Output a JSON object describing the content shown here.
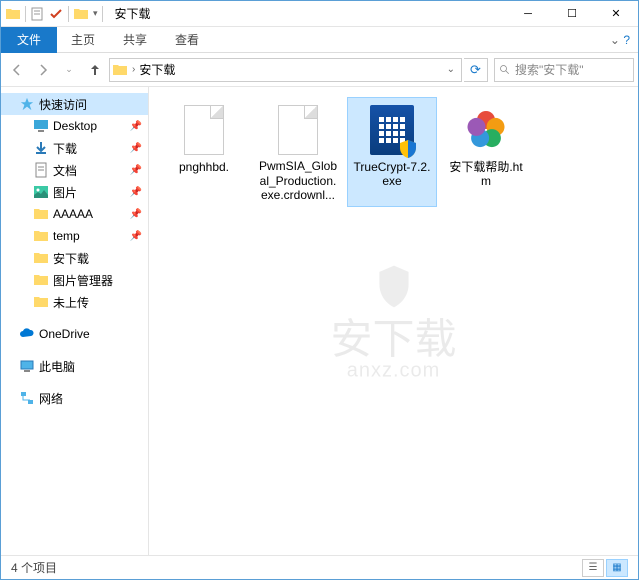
{
  "window": {
    "title": "安下载"
  },
  "ribbon": {
    "file": "文件",
    "home": "主页",
    "share": "共享",
    "view": "查看"
  },
  "address": {
    "current": "安下载",
    "search_placeholder": "搜索\"安下载\""
  },
  "nav": {
    "quick_access": "快速访问",
    "items": [
      {
        "label": "Desktop",
        "icon": "desktop",
        "pinned": true
      },
      {
        "label": "下载",
        "icon": "download",
        "pinned": true
      },
      {
        "label": "文档",
        "icon": "doc",
        "pinned": true
      },
      {
        "label": "图片",
        "icon": "picture",
        "pinned": true
      },
      {
        "label": "AAAAA",
        "icon": "folder",
        "pinned": true
      },
      {
        "label": "temp",
        "icon": "folder",
        "pinned": true
      },
      {
        "label": "安下载",
        "icon": "folder",
        "pinned": false
      },
      {
        "label": "图片管理器",
        "icon": "folder",
        "pinned": false
      },
      {
        "label": "未上传",
        "icon": "folder",
        "pinned": false
      }
    ],
    "onedrive": "OneDrive",
    "this_pc": "此电脑",
    "network": "网络"
  },
  "files": [
    {
      "name": "pnghhbd.",
      "type": "blank",
      "selected": false
    },
    {
      "name": "PwmSIA_Global_Production.exe.crdownl...",
      "type": "blank",
      "selected": false
    },
    {
      "name": "TrueCrypt-7.2.exe",
      "type": "exe",
      "selected": true
    },
    {
      "name": "安下载帮助.htm",
      "type": "htm",
      "selected": false
    }
  ],
  "status": {
    "count": "4 个项目"
  },
  "watermark": {
    "main": "安下载",
    "sub": "anxz.com"
  }
}
